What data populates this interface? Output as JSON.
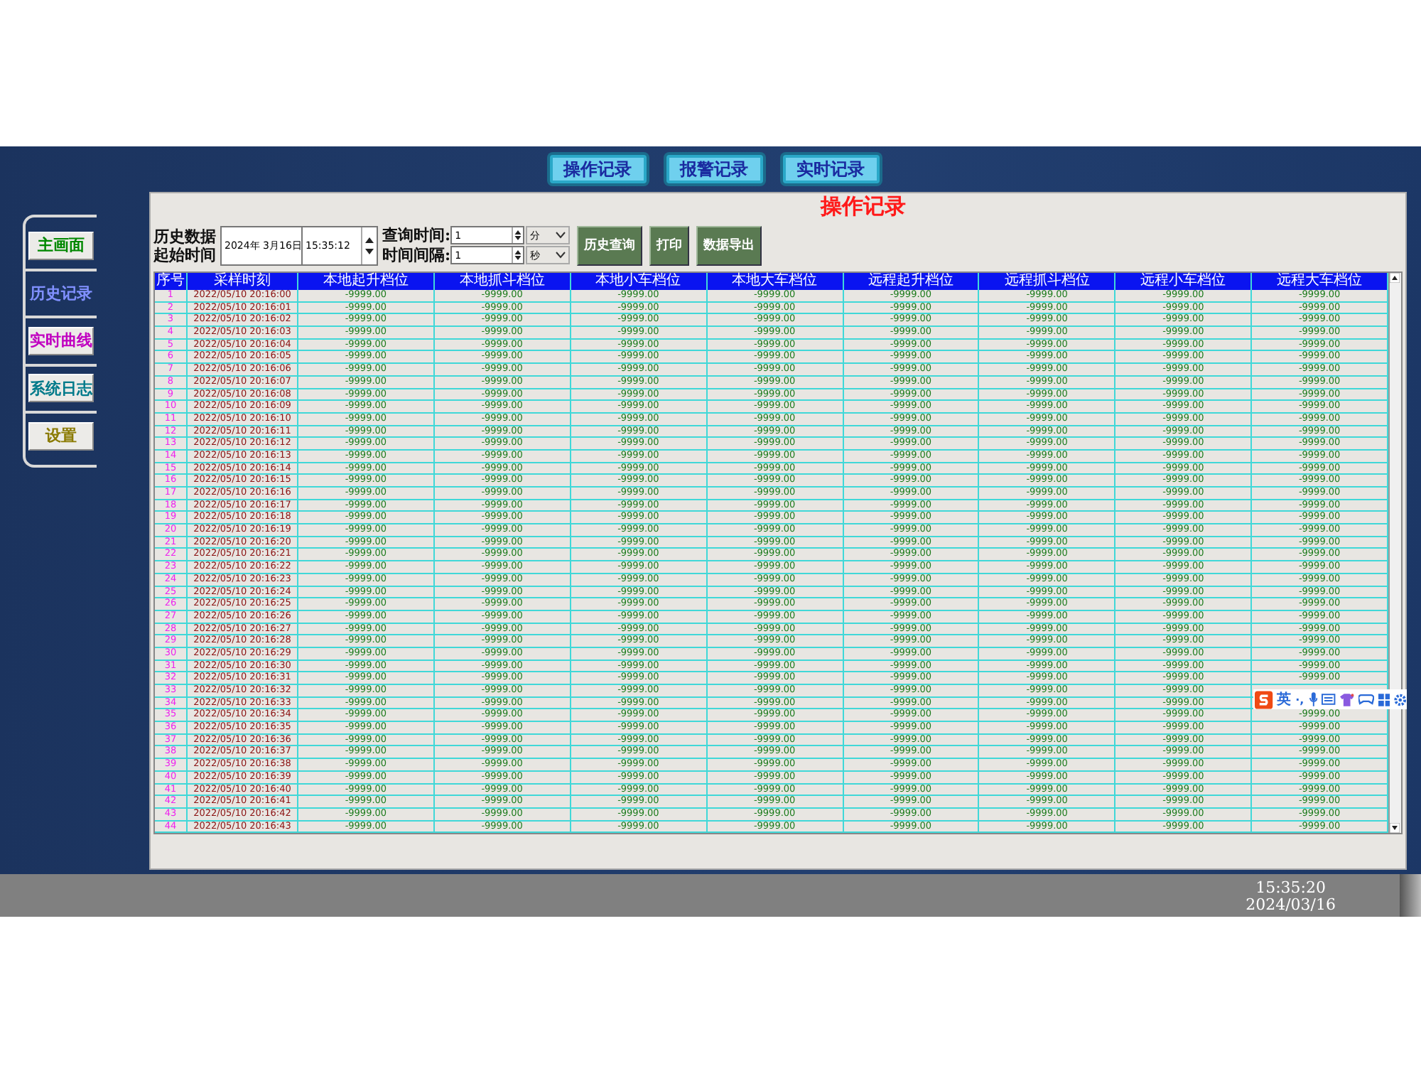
{
  "top_tabs": [
    {
      "label": "操作记录"
    },
    {
      "label": "报警记录"
    },
    {
      "label": "实时记录"
    }
  ],
  "sidebar": {
    "items": [
      {
        "label": "主画面",
        "color": "#008800",
        "selected": false
      },
      {
        "label": "历史记录",
        "color": "#8090ff",
        "selected": true
      },
      {
        "label": "实时曲线",
        "color": "#c000c0",
        "selected": false
      },
      {
        "label": "系统日志",
        "color": "#007a8a",
        "selected": false
      },
      {
        "label": "设置",
        "color": "#8a7a00",
        "selected": false
      }
    ]
  },
  "page_title": "操作记录",
  "query": {
    "start_label": [
      "历史数据",
      "起始时间"
    ],
    "date": "2024年 3月16日",
    "time": "15:35:12",
    "duration_label": "查询时间:",
    "duration": "1",
    "duration_unit": "分",
    "interval_label": "时间间隔:",
    "interval": "1",
    "interval_unit": "秒",
    "buttons": [
      "历史查询",
      "打印",
      "数据导出"
    ]
  },
  "table": {
    "columns": [
      "序号",
      "采样时刻",
      "本地起升档位",
      "本地抓斗档位",
      "本地小车档位",
      "本地大车档位",
      "远程起升档位",
      "远程抓斗档位",
      "远程小车档位",
      "远程大车档位"
    ],
    "rows": [
      {
        "no": "1",
        "time": "2022/05/10 20:16:00",
        "values": [
          "-9999.00",
          "-9999.00",
          "-9999.00",
          "-9999.00",
          "-9999.00",
          "-9999.00",
          "-9999.00",
          "-9999.00"
        ]
      },
      {
        "no": "2",
        "time": "2022/05/10 20:16:01",
        "values": [
          "-9999.00",
          "-9999.00",
          "-9999.00",
          "-9999.00",
          "-9999.00",
          "-9999.00",
          "-9999.00",
          "-9999.00"
        ]
      },
      {
        "no": "3",
        "time": "2022/05/10 20:16:02",
        "values": [
          "-9999.00",
          "-9999.00",
          "-9999.00",
          "-9999.00",
          "-9999.00",
          "-9999.00",
          "-9999.00",
          "-9999.00"
        ]
      },
      {
        "no": "4",
        "time": "2022/05/10 20:16:03",
        "values": [
          "-9999.00",
          "-9999.00",
          "-9999.00",
          "-9999.00",
          "-9999.00",
          "-9999.00",
          "-9999.00",
          "-9999.00"
        ]
      },
      {
        "no": "5",
        "time": "2022/05/10 20:16:04",
        "values": [
          "-9999.00",
          "-9999.00",
          "-9999.00",
          "-9999.00",
          "-9999.00",
          "-9999.00",
          "-9999.00",
          "-9999.00"
        ]
      },
      {
        "no": "6",
        "time": "2022/05/10 20:16:05",
        "values": [
          "-9999.00",
          "-9999.00",
          "-9999.00",
          "-9999.00",
          "-9999.00",
          "-9999.00",
          "-9999.00",
          "-9999.00"
        ]
      },
      {
        "no": "7",
        "time": "2022/05/10 20:16:06",
        "values": [
          "-9999.00",
          "-9999.00",
          "-9999.00",
          "-9999.00",
          "-9999.00",
          "-9999.00",
          "-9999.00",
          "-9999.00"
        ]
      },
      {
        "no": "8",
        "time": "2022/05/10 20:16:07",
        "values": [
          "-9999.00",
          "-9999.00",
          "-9999.00",
          "-9999.00",
          "-9999.00",
          "-9999.00",
          "-9999.00",
          "-9999.00"
        ]
      },
      {
        "no": "9",
        "time": "2022/05/10 20:16:08",
        "values": [
          "-9999.00",
          "-9999.00",
          "-9999.00",
          "-9999.00",
          "-9999.00",
          "-9999.00",
          "-9999.00",
          "-9999.00"
        ]
      },
      {
        "no": "10",
        "time": "2022/05/10 20:16:09",
        "values": [
          "-9999.00",
          "-9999.00",
          "-9999.00",
          "-9999.00",
          "-9999.00",
          "-9999.00",
          "-9999.00",
          "-9999.00"
        ]
      },
      {
        "no": "11",
        "time": "2022/05/10 20:16:10",
        "values": [
          "-9999.00",
          "-9999.00",
          "-9999.00",
          "-9999.00",
          "-9999.00",
          "-9999.00",
          "-9999.00",
          "-9999.00"
        ]
      },
      {
        "no": "12",
        "time": "2022/05/10 20:16:11",
        "values": [
          "-9999.00",
          "-9999.00",
          "-9999.00",
          "-9999.00",
          "-9999.00",
          "-9999.00",
          "-9999.00",
          "-9999.00"
        ]
      },
      {
        "no": "13",
        "time": "2022/05/10 20:16:12",
        "values": [
          "-9999.00",
          "-9999.00",
          "-9999.00",
          "-9999.00",
          "-9999.00",
          "-9999.00",
          "-9999.00",
          "-9999.00"
        ]
      },
      {
        "no": "14",
        "time": "2022/05/10 20:16:13",
        "values": [
          "-9999.00",
          "-9999.00",
          "-9999.00",
          "-9999.00",
          "-9999.00",
          "-9999.00",
          "-9999.00",
          "-9999.00"
        ]
      },
      {
        "no": "15",
        "time": "2022/05/10 20:16:14",
        "values": [
          "-9999.00",
          "-9999.00",
          "-9999.00",
          "-9999.00",
          "-9999.00",
          "-9999.00",
          "-9999.00",
          "-9999.00"
        ]
      },
      {
        "no": "16",
        "time": "2022/05/10 20:16:15",
        "values": [
          "-9999.00",
          "-9999.00",
          "-9999.00",
          "-9999.00",
          "-9999.00",
          "-9999.00",
          "-9999.00",
          "-9999.00"
        ]
      },
      {
        "no": "17",
        "time": "2022/05/10 20:16:16",
        "values": [
          "-9999.00",
          "-9999.00",
          "-9999.00",
          "-9999.00",
          "-9999.00",
          "-9999.00",
          "-9999.00",
          "-9999.00"
        ]
      },
      {
        "no": "18",
        "time": "2022/05/10 20:16:17",
        "values": [
          "-9999.00",
          "-9999.00",
          "-9999.00",
          "-9999.00",
          "-9999.00",
          "-9999.00",
          "-9999.00",
          "-9999.00"
        ]
      },
      {
        "no": "19",
        "time": "2022/05/10 20:16:18",
        "values": [
          "-9999.00",
          "-9999.00",
          "-9999.00",
          "-9999.00",
          "-9999.00",
          "-9999.00",
          "-9999.00",
          "-9999.00"
        ]
      },
      {
        "no": "20",
        "time": "2022/05/10 20:16:19",
        "values": [
          "-9999.00",
          "-9999.00",
          "-9999.00",
          "-9999.00",
          "-9999.00",
          "-9999.00",
          "-9999.00",
          "-9999.00"
        ]
      },
      {
        "no": "21",
        "time": "2022/05/10 20:16:20",
        "values": [
          "-9999.00",
          "-9999.00",
          "-9999.00",
          "-9999.00",
          "-9999.00",
          "-9999.00",
          "-9999.00",
          "-9999.00"
        ]
      },
      {
        "no": "22",
        "time": "2022/05/10 20:16:21",
        "values": [
          "-9999.00",
          "-9999.00",
          "-9999.00",
          "-9999.00",
          "-9999.00",
          "-9999.00",
          "-9999.00",
          "-9999.00"
        ]
      },
      {
        "no": "23",
        "time": "2022/05/10 20:16:22",
        "values": [
          "-9999.00",
          "-9999.00",
          "-9999.00",
          "-9999.00",
          "-9999.00",
          "-9999.00",
          "-9999.00",
          "-9999.00"
        ]
      },
      {
        "no": "24",
        "time": "2022/05/10 20:16:23",
        "values": [
          "-9999.00",
          "-9999.00",
          "-9999.00",
          "-9999.00",
          "-9999.00",
          "-9999.00",
          "-9999.00",
          "-9999.00"
        ]
      },
      {
        "no": "25",
        "time": "2022/05/10 20:16:24",
        "values": [
          "-9999.00",
          "-9999.00",
          "-9999.00",
          "-9999.00",
          "-9999.00",
          "-9999.00",
          "-9999.00",
          "-9999.00"
        ]
      },
      {
        "no": "26",
        "time": "2022/05/10 20:16:25",
        "values": [
          "-9999.00",
          "-9999.00",
          "-9999.00",
          "-9999.00",
          "-9999.00",
          "-9999.00",
          "-9999.00",
          "-9999.00"
        ]
      },
      {
        "no": "27",
        "time": "2022/05/10 20:16:26",
        "values": [
          "-9999.00",
          "-9999.00",
          "-9999.00",
          "-9999.00",
          "-9999.00",
          "-9999.00",
          "-9999.00",
          "-9999.00"
        ]
      },
      {
        "no": "28",
        "time": "2022/05/10 20:16:27",
        "values": [
          "-9999.00",
          "-9999.00",
          "-9999.00",
          "-9999.00",
          "-9999.00",
          "-9999.00",
          "-9999.00",
          "-9999.00"
        ]
      },
      {
        "no": "29",
        "time": "2022/05/10 20:16:28",
        "values": [
          "-9999.00",
          "-9999.00",
          "-9999.00",
          "-9999.00",
          "-9999.00",
          "-9999.00",
          "-9999.00",
          "-9999.00"
        ]
      },
      {
        "no": "30",
        "time": "2022/05/10 20:16:29",
        "values": [
          "-9999.00",
          "-9999.00",
          "-9999.00",
          "-9999.00",
          "-9999.00",
          "-9999.00",
          "-9999.00",
          "-9999.00"
        ]
      },
      {
        "no": "31",
        "time": "2022/05/10 20:16:30",
        "values": [
          "-9999.00",
          "-9999.00",
          "-9999.00",
          "-9999.00",
          "-9999.00",
          "-9999.00",
          "-9999.00",
          "-9999.00"
        ]
      },
      {
        "no": "32",
        "time": "2022/05/10 20:16:31",
        "values": [
          "-9999.00",
          "-9999.00",
          "-9999.00",
          "-9999.00",
          "-9999.00",
          "-9999.00",
          "-9999.00",
          "-9999.00"
        ]
      },
      {
        "no": "33",
        "time": "2022/05/10 20:16:32",
        "values": [
          "-9999.00",
          "-9999.00",
          "-9999.00",
          "-9999.00",
          "-9999.00",
          "-9999.00",
          "-9999.00"
        ]
      },
      {
        "no": "34",
        "time": "2022/05/10 20:16:33",
        "values": [
          "-9999.00",
          "-9999.00",
          "-9999.00",
          "-9999.00",
          "-9999.00",
          "-9999.00",
          "-9999.00"
        ]
      },
      {
        "no": "35",
        "time": "2022/05/10 20:16:34",
        "values": [
          "-9999.00",
          "-9999.00",
          "-9999.00",
          "-9999.00",
          "-9999.00",
          "-9999.00",
          "-9999.00",
          "-9999.00"
        ]
      },
      {
        "no": "36",
        "time": "2022/05/10 20:16:35",
        "values": [
          "-9999.00",
          "-9999.00",
          "-9999.00",
          "-9999.00",
          "-9999.00",
          "-9999.00",
          "-9999.00",
          "-9999.00"
        ]
      },
      {
        "no": "37",
        "time": "2022/05/10 20:16:36",
        "values": [
          "-9999.00",
          "-9999.00",
          "-9999.00",
          "-9999.00",
          "-9999.00",
          "-9999.00",
          "-9999.00",
          "-9999.00"
        ]
      },
      {
        "no": "38",
        "time": "2022/05/10 20:16:37",
        "values": [
          "-9999.00",
          "-9999.00",
          "-9999.00",
          "-9999.00",
          "-9999.00",
          "-9999.00",
          "-9999.00",
          "-9999.00"
        ]
      },
      {
        "no": "39",
        "time": "2022/05/10 20:16:38",
        "values": [
          "-9999.00",
          "-9999.00",
          "-9999.00",
          "-9999.00",
          "-9999.00",
          "-9999.00",
          "-9999.00",
          "-9999.00"
        ]
      },
      {
        "no": "40",
        "time": "2022/05/10 20:16:39",
        "values": [
          "-9999.00",
          "-9999.00",
          "-9999.00",
          "-9999.00",
          "-9999.00",
          "-9999.00",
          "-9999.00",
          "-9999.00"
        ]
      },
      {
        "no": "41",
        "time": "2022/05/10 20:16:40",
        "values": [
          "-9999.00",
          "-9999.00",
          "-9999.00",
          "-9999.00",
          "-9999.00",
          "-9999.00",
          "-9999.00",
          "-9999.00"
        ]
      },
      {
        "no": "42",
        "time": "2022/05/10 20:16:41",
        "values": [
          "-9999.00",
          "-9999.00",
          "-9999.00",
          "-9999.00",
          "-9999.00",
          "-9999.00",
          "-9999.00",
          "-9999.00"
        ]
      },
      {
        "no": "43",
        "time": "2022/05/10 20:16:42",
        "values": [
          "-9999.00",
          "-9999.00",
          "-9999.00",
          "-9999.00",
          "-9999.00",
          "-9999.00",
          "-9999.00",
          "-9999.00"
        ]
      },
      {
        "no": "44",
        "time": "2022/05/10 20:16:43",
        "values": [
          "-9999.00",
          "-9999.00",
          "-9999.00",
          "-9999.00",
          "-9999.00",
          "-9999.00",
          "-9999.00",
          "-9999.00"
        ]
      }
    ]
  },
  "ime_toolbar": {
    "mode": "英",
    "punct": "·,"
  },
  "status_bar": {
    "time": "15:35:20",
    "date": "2024/03/16"
  }
}
